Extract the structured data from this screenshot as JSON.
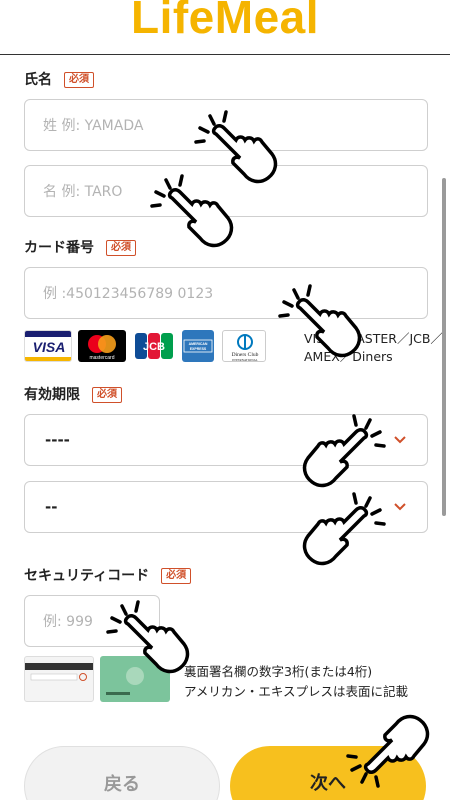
{
  "header": {
    "logo": "LifeMeal"
  },
  "name": {
    "label": "氏名",
    "required": "必須",
    "last_placeholder": "姓 例: YAMADA",
    "first_placeholder": "名 例: TARO"
  },
  "card": {
    "label": "カード番号",
    "required": "必須",
    "placeholder": "例 :450123456789 0123",
    "brands": [
      "VISA",
      "mastercard",
      "JCB",
      "AMERICAN EXPRESS",
      "Diners Club INTERNATIONAL"
    ],
    "brands_text_line1": "VISA／MASTER／JCB／",
    "brands_text_line2": "AMEX／Diners"
  },
  "expiry": {
    "label": "有効期限",
    "required": "必須",
    "month_value": "----",
    "year_value": "--"
  },
  "security": {
    "label": "セキュリティコード",
    "required": "必須",
    "placeholder": "例: 999",
    "note_line1": "裏面署名欄の数字3桁(または4桁)",
    "note_line2": "アメリカン・エキスプレスは表面に記載"
  },
  "buttons": {
    "back": "戻る",
    "next": "次へ"
  },
  "colors": {
    "brand": "#f5b400",
    "button_primary": "#f7c01e",
    "required": "#d0502a",
    "chevron": "#d0502a"
  },
  "icons": {
    "chevron": "chevron-down-icon",
    "hand": "tap-hand-icon"
  }
}
